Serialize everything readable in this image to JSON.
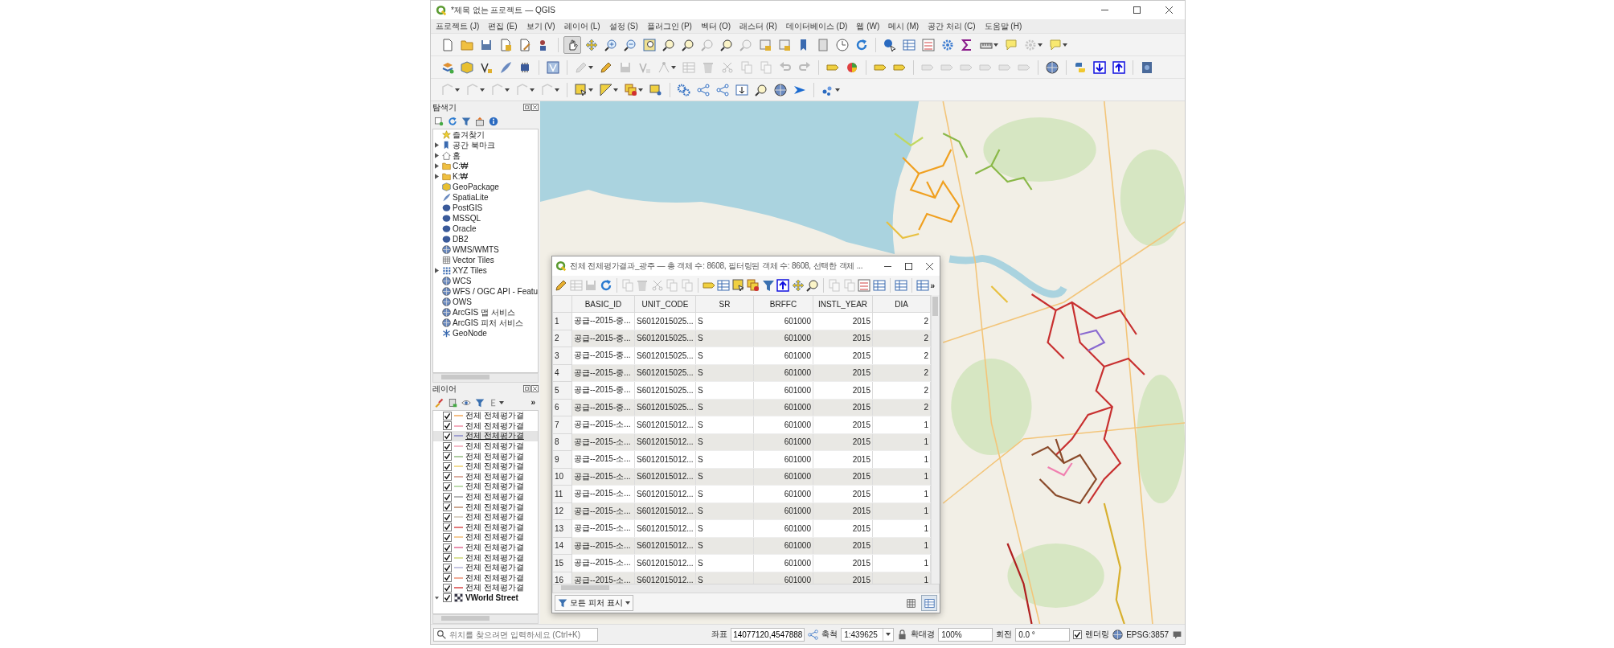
{
  "window": {
    "title": "*제목 없는 프로젝트 — QGIS"
  },
  "menu": [
    "프로젝트 (J)",
    "편집 (E)",
    "보기 (V)",
    "레이어 (L)",
    "설정 (S)",
    "플러그인 (P)",
    "벡터 (O)",
    "래스터 (R)",
    "데이터베이스 (D)",
    "웹 (W)",
    "메시 (M)",
    "공간 처리 (C)",
    "도움말 (H)"
  ],
  "toolbars": [
    {
      "items": [
        {
          "kind": "tool",
          "disabled": false,
          "pressed": false,
          "menu": false
        },
        {
          "kind": "tool",
          "disabled": false,
          "pressed": false,
          "menu": false
        },
        {
          "kind": "tool",
          "disabled": false,
          "pressed": false,
          "menu": false
        },
        {
          "kind": "tool",
          "disabled": false,
          "pressed": false,
          "menu": false
        },
        {
          "kind": "tool",
          "disabled": false,
          "pressed": false,
          "menu": false
        },
        {
          "kind": "tool",
          "disabled": false,
          "pressed": false,
          "menu": false
        },
        {
          "kind": "separator"
        },
        {
          "kind": "tool",
          "disabled": false,
          "pressed": true,
          "menu": false
        },
        {
          "kind": "tool",
          "disabled": false,
          "pressed": false,
          "menu": false
        },
        {
          "kind": "tool",
          "disabled": false,
          "pressed": false,
          "menu": false
        },
        {
          "kind": "tool",
          "disabled": false,
          "pressed": false,
          "menu": false
        },
        {
          "kind": "tool",
          "disabled": false,
          "pressed": false,
          "menu": false
        },
        {
          "kind": "tool",
          "disabled": false,
          "pressed": false,
          "menu": false
        },
        {
          "kind": "tool",
          "disabled": false,
          "pressed": false,
          "menu": false
        },
        {
          "kind": "tool",
          "disabled": true,
          "pressed": false,
          "menu": false
        },
        {
          "kind": "tool",
          "disabled": false,
          "pressed": false,
          "menu": false
        },
        {
          "kind": "tool",
          "disabled": true,
          "pressed": false,
          "menu": false
        },
        {
          "kind": "tool",
          "disabled": false,
          "pressed": false,
          "menu": false
        },
        {
          "kind": "tool",
          "disabled": false,
          "pressed": false,
          "menu": false
        },
        {
          "kind": "tool",
          "disabled": false,
          "pressed": false,
          "menu": false
        },
        {
          "kind": "tool",
          "disabled": false,
          "pressed": false,
          "menu": false
        },
        {
          "kind": "tool",
          "disabled": false,
          "pressed": false,
          "menu": false
        },
        {
          "kind": "tool",
          "disabled": false,
          "pressed": false,
          "menu": false
        },
        {
          "kind": "separator"
        },
        {
          "kind": "tool",
          "disabled": false,
          "pressed": false,
          "menu": false
        },
        {
          "kind": "tool",
          "disabled": false,
          "pressed": false,
          "menu": false
        },
        {
          "kind": "tool",
          "disabled": false,
          "pressed": false,
          "menu": false
        },
        {
          "kind": "tool",
          "disabled": false,
          "pressed": false,
          "menu": false
        },
        {
          "kind": "tool",
          "disabled": false,
          "pressed": false,
          "menu": false
        },
        {
          "kind": "tool",
          "disabled": false,
          "pressed": false,
          "menu": true
        },
        {
          "kind": "tool",
          "disabled": false,
          "pressed": false,
          "menu": false
        },
        {
          "kind": "tool",
          "disabled": true,
          "pressed": false,
          "menu": true
        },
        {
          "kind": "tool",
          "disabled": false,
          "pressed": false,
          "menu": true
        }
      ]
    },
    {
      "items": [
        {
          "kind": "tool",
          "disabled": false,
          "pressed": false,
          "menu": false
        },
        {
          "kind": "tool",
          "disabled": false,
          "pressed": false,
          "menu": false
        },
        {
          "kind": "tool",
          "disabled": false,
          "pressed": false,
          "menu": false
        },
        {
          "kind": "tool",
          "disabled": false,
          "pressed": false,
          "menu": false
        },
        {
          "kind": "tool",
          "disabled": false,
          "pressed": false,
          "menu": false
        },
        {
          "kind": "separator"
        },
        {
          "kind": "tool",
          "disabled": false,
          "pressed": false,
          "menu": false
        },
        {
          "kind": "separator"
        },
        {
          "kind": "tool",
          "disabled": true,
          "pressed": false,
          "menu": true
        },
        {
          "kind": "tool",
          "disabled": false,
          "pressed": false,
          "menu": false
        },
        {
          "kind": "tool",
          "disabled": true,
          "pressed": false,
          "menu": false
        },
        {
          "kind": "tool",
          "disabled": true,
          "pressed": false,
          "menu": false
        },
        {
          "kind": "tool",
          "disabled": true,
          "pressed": false,
          "menu": true
        },
        {
          "kind": "tool",
          "disabled": true,
          "pressed": false,
          "menu": false
        },
        {
          "kind": "tool",
          "disabled": true,
          "pressed": false,
          "menu": false
        },
        {
          "kind": "tool",
          "disabled": true,
          "pressed": false,
          "menu": false
        },
        {
          "kind": "tool",
          "disabled": true,
          "pressed": false,
          "menu": false
        },
        {
          "kind": "tool",
          "disabled": true,
          "pressed": false,
          "menu": false
        },
        {
          "kind": "tool",
          "disabled": true,
          "pressed": false,
          "menu": false
        },
        {
          "kind": "tool",
          "disabled": true,
          "pressed": false,
          "menu": false
        },
        {
          "kind": "separator"
        },
        {
          "kind": "tool",
          "disabled": false,
          "pressed": false,
          "menu": false
        },
        {
          "kind": "tool",
          "disabled": false,
          "pressed": false,
          "menu": false
        },
        {
          "kind": "separator"
        },
        {
          "kind": "tool",
          "disabled": false,
          "pressed": false,
          "menu": false
        },
        {
          "kind": "tool",
          "disabled": false,
          "pressed": false,
          "menu": false
        },
        {
          "kind": "separator"
        },
        {
          "kind": "tool",
          "disabled": true,
          "pressed": false,
          "menu": false
        },
        {
          "kind": "tool",
          "disabled": true,
          "pressed": false,
          "menu": false
        },
        {
          "kind": "tool",
          "disabled": true,
          "pressed": false,
          "menu": false
        },
        {
          "kind": "tool",
          "disabled": true,
          "pressed": false,
          "menu": false
        },
        {
          "kind": "tool",
          "disabled": true,
          "pressed": false,
          "menu": false
        },
        {
          "kind": "tool",
          "disabled": true,
          "pressed": false,
          "menu": false
        },
        {
          "kind": "separator"
        },
        {
          "kind": "tool",
          "disabled": false,
          "pressed": false,
          "menu": false
        },
        {
          "kind": "separator"
        },
        {
          "kind": "tool",
          "disabled": false,
          "pressed": false,
          "menu": false
        },
        {
          "kind": "tool",
          "disabled": false,
          "pressed": false,
          "menu": false
        },
        {
          "kind": "tool",
          "disabled": false,
          "pressed": false,
          "menu": false
        },
        {
          "kind": "separator"
        },
        {
          "kind": "tool",
          "disabled": false,
          "pressed": false,
          "menu": false
        }
      ]
    },
    {
      "items": [
        {
          "kind": "tool",
          "disabled": true,
          "pressed": false,
          "menu": true
        },
        {
          "kind": "tool",
          "disabled": true,
          "pressed": false,
          "menu": true
        },
        {
          "kind": "tool",
          "disabled": true,
          "pressed": false,
          "menu": true
        },
        {
          "kind": "tool",
          "disabled": true,
          "pressed": false,
          "menu": true
        },
        {
          "kind": "tool",
          "disabled": true,
          "pressed": false,
          "menu": true
        },
        {
          "kind": "separator"
        },
        {
          "kind": "tool",
          "disabled": false,
          "pressed": false,
          "menu": true
        },
        {
          "kind": "tool",
          "disabled": false,
          "pressed": false,
          "menu": true
        },
        {
          "kind": "tool",
          "disabled": false,
          "pressed": false,
          "menu": true
        },
        {
          "kind": "tool",
          "disabled": false,
          "pressed": false,
          "menu": false
        },
        {
          "kind": "separator"
        },
        {
          "kind": "tool",
          "disabled": false,
          "pressed": false,
          "menu": false
        },
        {
          "kind": "tool",
          "disabled": false,
          "pressed": false,
          "menu": false
        },
        {
          "kind": "tool",
          "disabled": false,
          "pressed": false,
          "menu": false
        },
        {
          "kind": "tool",
          "disabled": false,
          "pressed": false,
          "menu": false
        },
        {
          "kind": "tool",
          "disabled": false,
          "pressed": false,
          "menu": false
        },
        {
          "kind": "tool",
          "disabled": false,
          "pressed": false,
          "menu": false
        },
        {
          "kind": "tool",
          "disabled": false,
          "pressed": false,
          "menu": false
        },
        {
          "kind": "separator"
        },
        {
          "kind": "tool",
          "disabled": false,
          "pressed": false,
          "menu": true
        }
      ]
    }
  ],
  "browser": {
    "title": "탐색기",
    "items": [
      {
        "label": "즐겨찾기",
        "toggle": false
      },
      {
        "label": "공간 북마크",
        "toggle": true
      },
      {
        "label": "홈",
        "toggle": true
      },
      {
        "label": "C:₩",
        "toggle": true
      },
      {
        "label": "K:₩",
        "toggle": true
      },
      {
        "label": "GeoPackage",
        "toggle": false
      },
      {
        "label": "SpatiaLite",
        "toggle": false
      },
      {
        "label": "PostGIS",
        "toggle": false
      },
      {
        "label": "MSSQL",
        "toggle": false
      },
      {
        "label": "Oracle",
        "toggle": false
      },
      {
        "label": "DB2",
        "toggle": false
      },
      {
        "label": "WMS/WMTS",
        "toggle": false
      },
      {
        "label": "Vector Tiles",
        "toggle": false
      },
      {
        "label": "XYZ Tiles",
        "toggle": true
      },
      {
        "label": "WCS",
        "toggle": false
      },
      {
        "label": "WFS / OGC API - Featu",
        "toggle": false
      },
      {
        "label": "OWS",
        "toggle": false
      },
      {
        "label": "ArcGIS 맵 서비스",
        "toggle": false
      },
      {
        "label": "ArcGIS 피처 서비스",
        "toggle": false
      },
      {
        "label": "GeoNode",
        "toggle": false
      }
    ]
  },
  "layers": {
    "title": "레이어",
    "overflow": "»",
    "items": [
      {
        "label": "전체 전체평가결",
        "kind": "line",
        "checked": true,
        "selected": false,
        "color": "#f5b97a"
      },
      {
        "label": "전체 전체평가결",
        "kind": "line",
        "checked": true,
        "selected": false,
        "color": "#f2a6b9"
      },
      {
        "label": "전체 전체평가결",
        "kind": "line",
        "checked": true,
        "selected": true,
        "color": "#9a9ad0"
      },
      {
        "label": "전체 전체평가결",
        "kind": "line",
        "checked": true,
        "selected": false,
        "color": "#f4b6c4"
      },
      {
        "label": "전체 전체평가결",
        "kind": "line",
        "checked": true,
        "selected": false,
        "color": "#a8c89a"
      },
      {
        "label": "전체 전체평가결",
        "kind": "line",
        "checked": true,
        "selected": false,
        "color": "#f0d88a"
      },
      {
        "label": "전체 전체평가결",
        "kind": "line",
        "checked": true,
        "selected": false,
        "color": "#d8a898"
      },
      {
        "label": "전체 전체평가결",
        "kind": "line",
        "checked": true,
        "selected": false,
        "color": "#b8d8a8"
      },
      {
        "label": "전체 전체평가결",
        "kind": "line",
        "checked": true,
        "selected": false,
        "color": "#b0b0b0"
      },
      {
        "label": "전체 전체평가결",
        "kind": "line",
        "checked": true,
        "selected": false,
        "color": "#c8a088"
      },
      {
        "label": "전체 전체평가결",
        "kind": "line",
        "checked": true,
        "selected": false,
        "color": "#d8cfc0"
      },
      {
        "label": "전체 전체평가결",
        "kind": "line",
        "checked": true,
        "selected": false,
        "color": "#e07070"
      },
      {
        "label": "전체 전체평가결",
        "kind": "line",
        "checked": true,
        "selected": false,
        "color": "#f5c890"
      },
      {
        "label": "전체 전체평가결",
        "kind": "line",
        "checked": true,
        "selected": false,
        "color": "#e888a8"
      },
      {
        "label": "전체 전체평가결",
        "kind": "line",
        "checked": true,
        "selected": false,
        "color": "#d8e090"
      },
      {
        "label": "전체 전체평가결",
        "kind": "line",
        "checked": true,
        "selected": false,
        "color": "#c0c0e0"
      },
      {
        "label": "전체 전체평가결",
        "kind": "line",
        "checked": true,
        "selected": false,
        "color": "#f0a890"
      },
      {
        "label": "전체 전체평가결",
        "kind": "line",
        "checked": true,
        "selected": false,
        "color": "#e06868"
      },
      {
        "label": "VWorld Street",
        "kind": "raster",
        "checked": true,
        "selected": false,
        "expanded": true
      }
    ]
  },
  "attribute_table": {
    "title": "전체 전체평가결과_광주 — 총 객체 수: 8608, 필터링된 객체 수: 8608, 선택한 객체 ...",
    "overflow": "»",
    "toolbar": [
      {
        "kind": "tool",
        "disabled": false,
        "pressed": false,
        "menu": false
      },
      {
        "kind": "tool",
        "disabled": true,
        "pressed": false,
        "menu": false
      },
      {
        "kind": "tool",
        "disabled": true,
        "pressed": false,
        "menu": false
      },
      {
        "kind": "tool",
        "disabled": false,
        "pressed": false,
        "menu": false
      },
      {
        "kind": "separator"
      },
      {
        "kind": "tool",
        "disabled": true,
        "pressed": false,
        "menu": false
      },
      {
        "kind": "tool",
        "disabled": true,
        "pressed": false,
        "menu": false
      },
      {
        "kind": "tool",
        "disabled": true,
        "pressed": false,
        "menu": false
      },
      {
        "kind": "tool",
        "disabled": true,
        "pressed": false,
        "menu": false
      },
      {
        "kind": "tool",
        "disabled": true,
        "pressed": false,
        "menu": false
      },
      {
        "kind": "separator"
      },
      {
        "kind": "tool",
        "disabled": false,
        "pressed": false,
        "menu": false
      },
      {
        "kind": "tool",
        "disabled": false,
        "pressed": false,
        "menu": false
      },
      {
        "kind": "tool",
        "disabled": false,
        "pressed": false,
        "menu": false
      },
      {
        "kind": "tool",
        "disabled": false,
        "pressed": false,
        "menu": false
      },
      {
        "kind": "tool",
        "disabled": false,
        "pressed": false,
        "menu": false
      },
      {
        "kind": "tool",
        "disabled": false,
        "pressed": false,
        "menu": false
      },
      {
        "kind": "tool",
        "disabled": false,
        "pressed": false,
        "menu": false
      },
      {
        "kind": "tool",
        "disabled": false,
        "pressed": false,
        "menu": false
      },
      {
        "kind": "separator"
      },
      {
        "kind": "tool",
        "disabled": true,
        "pressed": false,
        "menu": false
      },
      {
        "kind": "tool",
        "disabled": true,
        "pressed": false,
        "menu": false
      },
      {
        "kind": "tool",
        "disabled": false,
        "pressed": false,
        "menu": false
      },
      {
        "kind": "tool",
        "disabled": false,
        "pressed": false,
        "menu": false
      },
      {
        "kind": "separator"
      },
      {
        "kind": "tool",
        "disabled": false,
        "pressed": false,
        "menu": false
      },
      {
        "kind": "separator"
      },
      {
        "kind": "tool",
        "disabled": false,
        "pressed": false,
        "menu": false
      }
    ],
    "columns": [
      "BASIC_ID",
      "UNIT_CODE",
      "SR",
      "BRFFC",
      "INSTL_YEAR",
      "DIA"
    ],
    "rows": [
      {
        "number": "1",
        "cells": [
          "공급--2015-중...",
          "S6012015025...",
          "S",
          "601000",
          "2015",
          "2"
        ]
      },
      {
        "number": "2",
        "cells": [
          "공급--2015-중...",
          "S6012015025...",
          "S",
          "601000",
          "2015",
          "2"
        ]
      },
      {
        "number": "3",
        "cells": [
          "공급--2015-중...",
          "S6012015025...",
          "S",
          "601000",
          "2015",
          "2"
        ]
      },
      {
        "number": "4",
        "cells": [
          "공급--2015-중...",
          "S6012015025...",
          "S",
          "601000",
          "2015",
          "2"
        ]
      },
      {
        "number": "5",
        "cells": [
          "공급--2015-중...",
          "S6012015025...",
          "S",
          "601000",
          "2015",
          "2"
        ]
      },
      {
        "number": "6",
        "cells": [
          "공급--2015-중...",
          "S6012015025...",
          "S",
          "601000",
          "2015",
          "2"
        ]
      },
      {
        "number": "7",
        "cells": [
          "공급--2015-소...",
          "S6012015012...",
          "S",
          "601000",
          "2015",
          "1"
        ]
      },
      {
        "number": "8",
        "cells": [
          "공급--2015-소...",
          "S6012015012...",
          "S",
          "601000",
          "2015",
          "1"
        ]
      },
      {
        "number": "9",
        "cells": [
          "공급--2015-소...",
          "S6012015012...",
          "S",
          "601000",
          "2015",
          "1"
        ]
      },
      {
        "number": "10",
        "cells": [
          "공급--2015-소...",
          "S6012015012...",
          "S",
          "601000",
          "2015",
          "1"
        ]
      },
      {
        "number": "11",
        "cells": [
          "공급--2015-소...",
          "S6012015012...",
          "S",
          "601000",
          "2015",
          "1"
        ]
      },
      {
        "number": "12",
        "cells": [
          "공급--2015-소...",
          "S6012015012...",
          "S",
          "601000",
          "2015",
          "1"
        ]
      },
      {
        "number": "13",
        "cells": [
          "공급--2015-소...",
          "S6012015012...",
          "S",
          "601000",
          "2015",
          "1"
        ]
      },
      {
        "number": "14",
        "cells": [
          "공급--2015-소...",
          "S6012015012...",
          "S",
          "601000",
          "2015",
          "1"
        ]
      },
      {
        "number": "15",
        "cells": [
          "공급--2015-소...",
          "S6012015012...",
          "S",
          "601000",
          "2015",
          "1"
        ]
      },
      {
        "number": "16",
        "cells": [
          "공급--2015-소...",
          "S6012015012...",
          "S",
          "601000",
          "2015",
          "1"
        ]
      }
    ],
    "filter_button": "모든 피처 표시",
    "view_buttons": [
      {
        "selected": false
      },
      {
        "selected": true
      }
    ]
  },
  "status_bar": {
    "search_placeholder": "위치를 찾으려면 입력하세요 (Ctrl+K)",
    "coordinate_label": "좌표",
    "coordinate": "14077120,4547888",
    "scale_label": "축척",
    "scale": "1:439625",
    "magnifier_label": "확대경",
    "magnifier": "100%",
    "rotation_label": "회전",
    "rotation": "0.0 °",
    "render_label": "렌더링",
    "render_checked": true,
    "crs": "EPSG:3857"
  }
}
